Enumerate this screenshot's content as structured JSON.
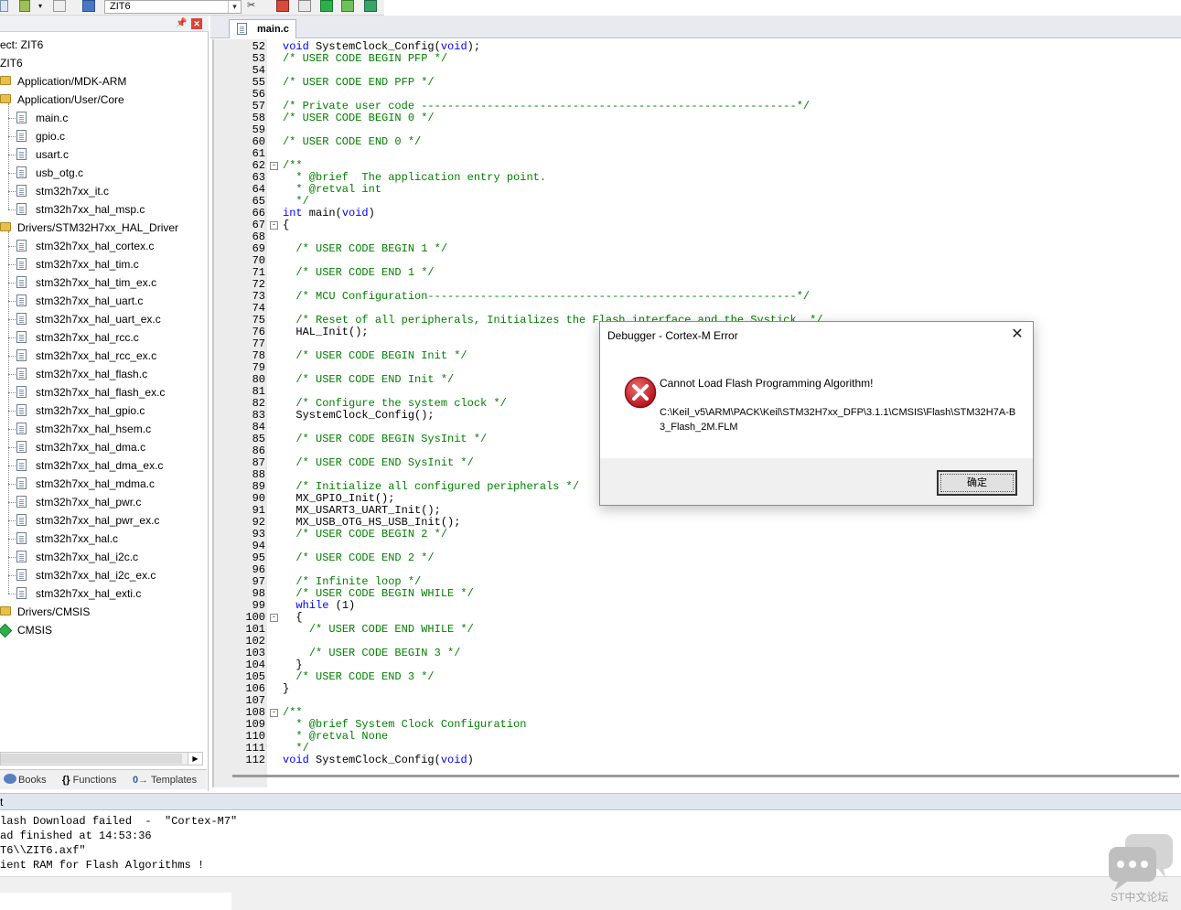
{
  "toolbar": {
    "target_name": "ZIT6"
  },
  "project_panel": {
    "root_project": "ect: ZIT6",
    "root_target": "ZIT6",
    "tree": [
      {
        "label": "Application/MDK-ARM",
        "kind": "folder"
      },
      {
        "label": "Application/User/Core",
        "kind": "folder"
      },
      {
        "label": "main.c",
        "kind": "file"
      },
      {
        "label": "gpio.c",
        "kind": "file"
      },
      {
        "label": "usart.c",
        "kind": "file"
      },
      {
        "label": "usb_otg.c",
        "kind": "file"
      },
      {
        "label": "stm32h7xx_it.c",
        "kind": "file"
      },
      {
        "label": "stm32h7xx_hal_msp.c",
        "kind": "file"
      },
      {
        "label": "Drivers/STM32H7xx_HAL_Driver",
        "kind": "folder"
      },
      {
        "label": "stm32h7xx_hal_cortex.c",
        "kind": "file"
      },
      {
        "label": "stm32h7xx_hal_tim.c",
        "kind": "file"
      },
      {
        "label": "stm32h7xx_hal_tim_ex.c",
        "kind": "file"
      },
      {
        "label": "stm32h7xx_hal_uart.c",
        "kind": "file"
      },
      {
        "label": "stm32h7xx_hal_uart_ex.c",
        "kind": "file"
      },
      {
        "label": "stm32h7xx_hal_rcc.c",
        "kind": "file"
      },
      {
        "label": "stm32h7xx_hal_rcc_ex.c",
        "kind": "file"
      },
      {
        "label": "stm32h7xx_hal_flash.c",
        "kind": "file"
      },
      {
        "label": "stm32h7xx_hal_flash_ex.c",
        "kind": "file"
      },
      {
        "label": "stm32h7xx_hal_gpio.c",
        "kind": "file"
      },
      {
        "label": "stm32h7xx_hal_hsem.c",
        "kind": "file"
      },
      {
        "label": "stm32h7xx_hal_dma.c",
        "kind": "file"
      },
      {
        "label": "stm32h7xx_hal_dma_ex.c",
        "kind": "file"
      },
      {
        "label": "stm32h7xx_hal_mdma.c",
        "kind": "file"
      },
      {
        "label": "stm32h7xx_hal_pwr.c",
        "kind": "file"
      },
      {
        "label": "stm32h7xx_hal_pwr_ex.c",
        "kind": "file"
      },
      {
        "label": "stm32h7xx_hal.c",
        "kind": "file"
      },
      {
        "label": "stm32h7xx_hal_i2c.c",
        "kind": "file"
      },
      {
        "label": "stm32h7xx_hal_i2c_ex.c",
        "kind": "file"
      },
      {
        "label": "stm32h7xx_hal_exti.c",
        "kind": "file"
      },
      {
        "label": "Drivers/CMSIS",
        "kind": "folder"
      },
      {
        "label": "CMSIS",
        "kind": "pack"
      }
    ],
    "tabs": {
      "books": "Books",
      "functions_sym": "{}",
      "functions": "Functions",
      "templates_sym": "0→",
      "templates": "Templates"
    }
  },
  "editor": {
    "tab_label": "main.c",
    "lines": [
      {
        "n": "52",
        "t": "void SystemClock_Config(void);",
        "fold": ""
      },
      {
        "n": "53",
        "t": "/* USER CODE BEGIN PFP */",
        "fold": ""
      },
      {
        "n": "54",
        "t": "",
        "fold": ""
      },
      {
        "n": "55",
        "t": "/* USER CODE END PFP */",
        "fold": ""
      },
      {
        "n": "56",
        "t": "",
        "fold": ""
      },
      {
        "n": "57",
        "t": "/* Private user code ---------------------------------------------------------*/",
        "fold": ""
      },
      {
        "n": "58",
        "t": "/* USER CODE BEGIN 0 */",
        "fold": ""
      },
      {
        "n": "59",
        "t": "",
        "fold": ""
      },
      {
        "n": "60",
        "t": "/* USER CODE END 0 */",
        "fold": ""
      },
      {
        "n": "61",
        "t": "",
        "fold": ""
      },
      {
        "n": "62",
        "t": "/**",
        "fold": "-"
      },
      {
        "n": "63",
        "t": "  * @brief  The application entry point.",
        "fold": ""
      },
      {
        "n": "64",
        "t": "  * @retval int",
        "fold": ""
      },
      {
        "n": "65",
        "t": "  */",
        "fold": ""
      },
      {
        "n": "66",
        "t": "int main(void)",
        "fold": ""
      },
      {
        "n": "67",
        "t": "{",
        "fold": "-"
      },
      {
        "n": "68",
        "t": "",
        "fold": ""
      },
      {
        "n": "69",
        "t": "  /* USER CODE BEGIN 1 */",
        "fold": ""
      },
      {
        "n": "70",
        "t": "",
        "fold": ""
      },
      {
        "n": "71",
        "t": "  /* USER CODE END 1 */",
        "fold": ""
      },
      {
        "n": "72",
        "t": "",
        "fold": ""
      },
      {
        "n": "73",
        "t": "  /* MCU Configuration--------------------------------------------------------*/",
        "fold": ""
      },
      {
        "n": "74",
        "t": "",
        "fold": ""
      },
      {
        "n": "75",
        "t": "  /* Reset of all peripherals, Initializes the Flash interface and the Systick. */",
        "fold": ""
      },
      {
        "n": "76",
        "t": "  HAL_Init();",
        "fold": ""
      },
      {
        "n": "77",
        "t": "",
        "fold": ""
      },
      {
        "n": "78",
        "t": "  /* USER CODE BEGIN Init */",
        "fold": ""
      },
      {
        "n": "79",
        "t": "",
        "fold": ""
      },
      {
        "n": "80",
        "t": "  /* USER CODE END Init */",
        "fold": ""
      },
      {
        "n": "81",
        "t": "",
        "fold": ""
      },
      {
        "n": "82",
        "t": "  /* Configure the system clock */",
        "fold": ""
      },
      {
        "n": "83",
        "t": "  SystemClock_Config();",
        "fold": ""
      },
      {
        "n": "84",
        "t": "",
        "fold": ""
      },
      {
        "n": "85",
        "t": "  /* USER CODE BEGIN SysInit */",
        "fold": ""
      },
      {
        "n": "86",
        "t": "",
        "fold": ""
      },
      {
        "n": "87",
        "t": "  /* USER CODE END SysInit */",
        "fold": ""
      },
      {
        "n": "88",
        "t": "",
        "fold": ""
      },
      {
        "n": "89",
        "t": "  /* Initialize all configured peripherals */",
        "fold": ""
      },
      {
        "n": "90",
        "t": "  MX_GPIO_Init();",
        "fold": ""
      },
      {
        "n": "91",
        "t": "  MX_USART3_UART_Init();",
        "fold": ""
      },
      {
        "n": "92",
        "t": "  MX_USB_OTG_HS_USB_Init();",
        "fold": ""
      },
      {
        "n": "93",
        "t": "  /* USER CODE BEGIN 2 */",
        "fold": ""
      },
      {
        "n": "94",
        "t": "",
        "fold": ""
      },
      {
        "n": "95",
        "t": "  /* USER CODE END 2 */",
        "fold": ""
      },
      {
        "n": "96",
        "t": "",
        "fold": ""
      },
      {
        "n": "97",
        "t": "  /* Infinite loop */",
        "fold": ""
      },
      {
        "n": "98",
        "t": "  /* USER CODE BEGIN WHILE */",
        "fold": ""
      },
      {
        "n": "99",
        "t": "  while (1)",
        "fold": ""
      },
      {
        "n": "100",
        "t": "  {",
        "fold": "-"
      },
      {
        "n": "101",
        "t": "    /* USER CODE END WHILE */",
        "fold": ""
      },
      {
        "n": "102",
        "t": "",
        "fold": ""
      },
      {
        "n": "103",
        "t": "    /* USER CODE BEGIN 3 */",
        "fold": ""
      },
      {
        "n": "104",
        "t": "  }",
        "fold": ""
      },
      {
        "n": "105",
        "t": "  /* USER CODE END 3 */",
        "fold": ""
      },
      {
        "n": "106",
        "t": "}",
        "fold": ""
      },
      {
        "n": "107",
        "t": "",
        "fold": ""
      },
      {
        "n": "108",
        "t": "/**",
        "fold": "-"
      },
      {
        "n": "109",
        "t": "  * @brief System Clock Configuration",
        "fold": ""
      },
      {
        "n": "110",
        "t": "  * @retval None",
        "fold": ""
      },
      {
        "n": "111",
        "t": "  */",
        "fold": ""
      },
      {
        "n": "112",
        "t": "void SystemClock_Config(void)",
        "fold": ""
      }
    ]
  },
  "output": {
    "header": "t",
    "lines": [
      "lash Download failed  -  \"Cortex-M7\"",
      "ad finished at 14:53:36",
      "T6\\\\ZIT6.axf\"",
      "ient RAM for Flash Algorithms !"
    ]
  },
  "dialog": {
    "title": "Debugger - Cortex-M Error",
    "close_glyph": "✕",
    "heading": "Cannot Load Flash Programming Algorithm!",
    "path": "C:\\Keil_v5\\ARM\\PACK\\Keil\\STM32H7xx_DFP\\3.1.1\\CMSIS\\Flash\\STM32H7A-B3_Flash_2M.FLM",
    "ok_label": "确定"
  },
  "watermark": {
    "text": "ST中文论坛"
  },
  "colors": {
    "comment": "#008000",
    "keyword": "#0000ff",
    "error_red": "#d0262d",
    "folder": "#e8bf4a",
    "pack_green": "#2bb04a"
  }
}
